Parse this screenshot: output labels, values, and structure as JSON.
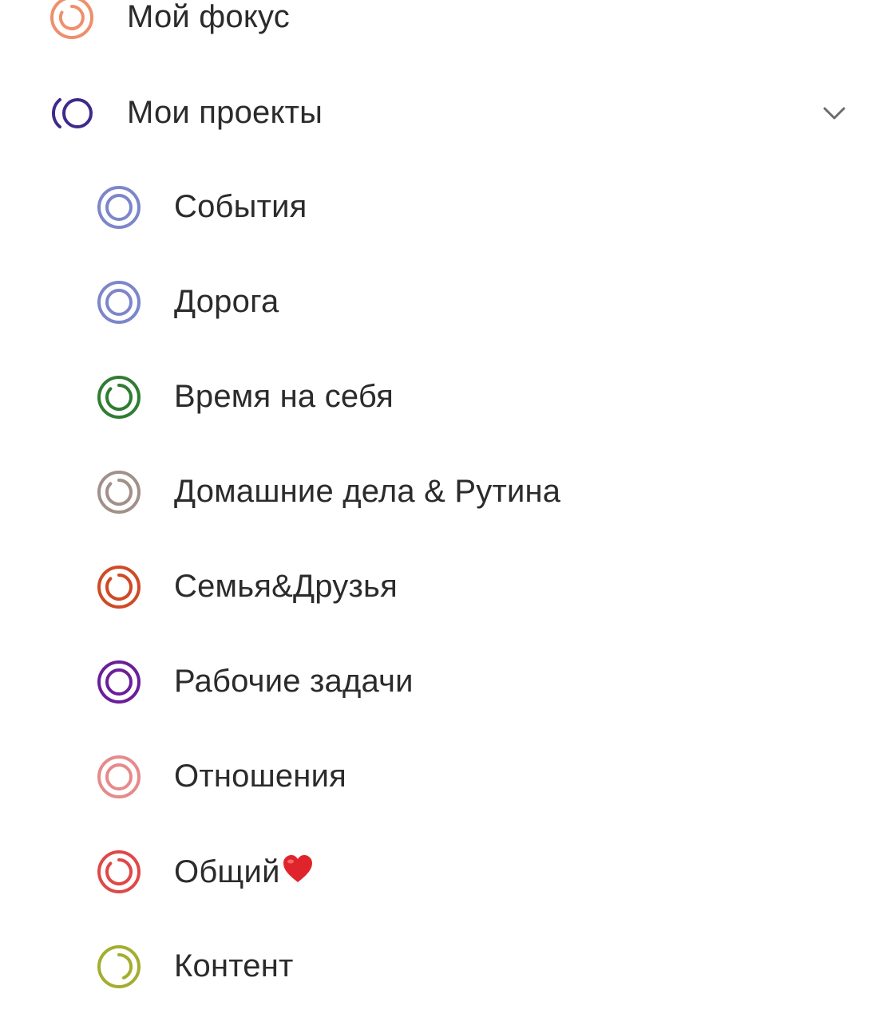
{
  "focus": {
    "label": "Мой фокус",
    "icon": "focus-ring-icon",
    "color": "#ef8f6b"
  },
  "projects": {
    "label": "Мои проекты",
    "icon": "projects-ring-icon",
    "color": "#3f2a8c",
    "expanded": true,
    "items": [
      {
        "label": "События",
        "icon": "project-ring-icon",
        "color": "#7c86c9"
      },
      {
        "label": "Дорога",
        "icon": "project-ring-icon",
        "color": "#7c86c9"
      },
      {
        "label": "Время на себя",
        "icon": "project-ring-icon",
        "color": "#2f7d32"
      },
      {
        "label": "Домашние дела & Рутина",
        "icon": "project-ring-icon",
        "color": "#a2908a"
      },
      {
        "label": "Семья&Друзья",
        "icon": "project-ring-icon",
        "color": "#cf4a25"
      },
      {
        "label": "Рабочие задачи",
        "icon": "project-ring-icon",
        "color": "#6a1f9a"
      },
      {
        "label": "Отношения",
        "icon": "project-ring-icon",
        "color": "#e68a8a"
      },
      {
        "label": "Общий",
        "icon": "project-ring-icon",
        "color": "#e04848",
        "emoji": "heart-emoji"
      },
      {
        "label": "Контент",
        "icon": "project-ring-icon",
        "color": "#a3ad2f"
      }
    ]
  }
}
